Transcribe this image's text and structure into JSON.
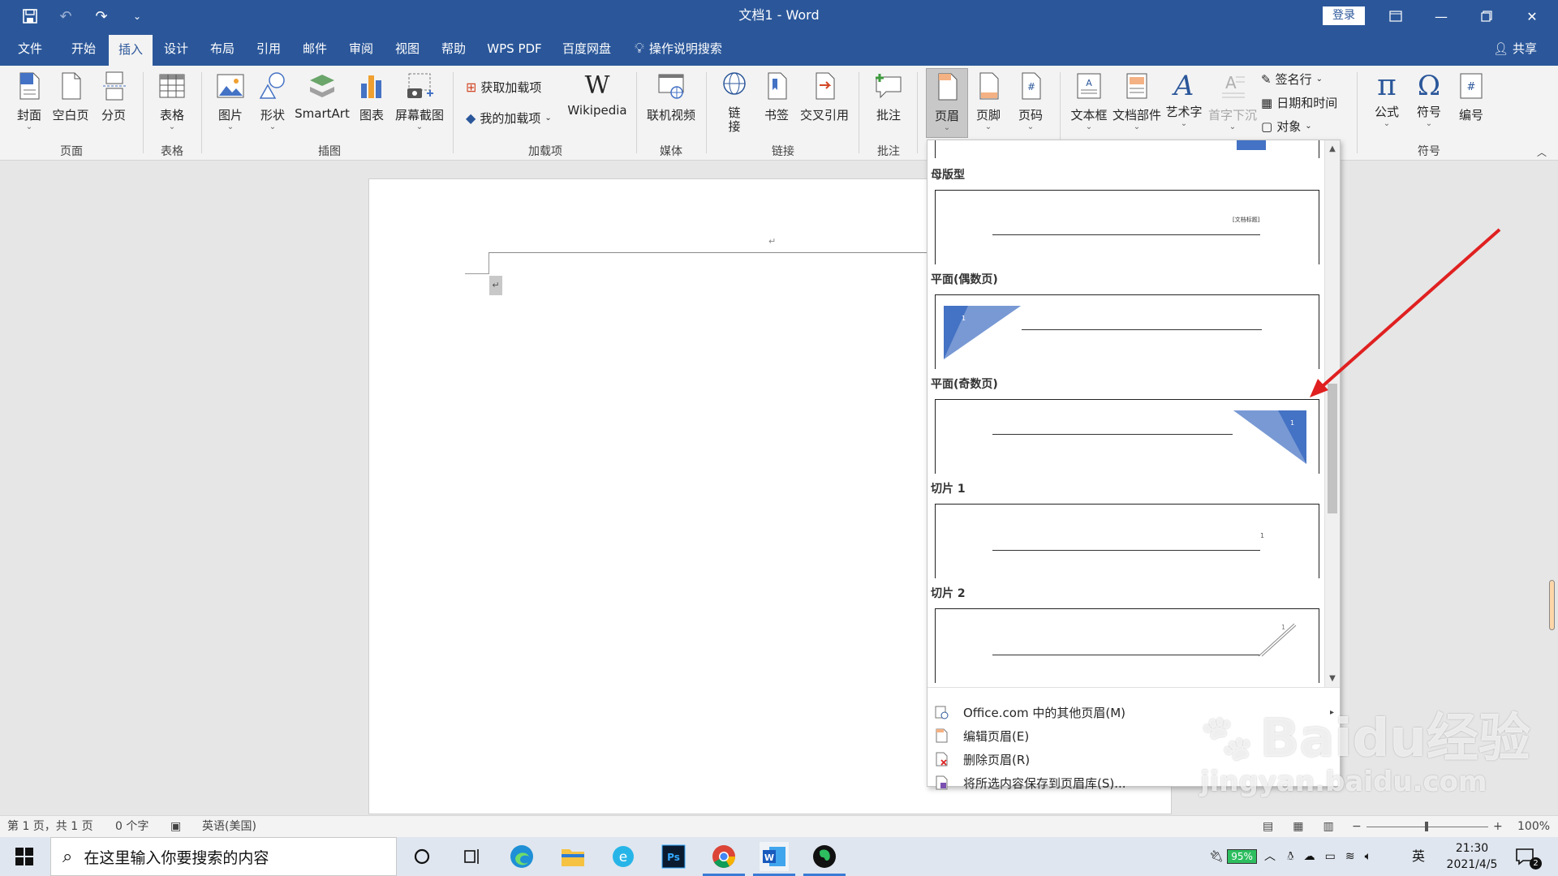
{
  "window": {
    "title": "文档1 - Word",
    "signin": "登录",
    "controls": [
      "restore-ribbon",
      "minimize",
      "maximize",
      "close"
    ]
  },
  "menu_tabs": [
    {
      "label": "文件",
      "active": false
    },
    {
      "label": "开始",
      "active": false
    },
    {
      "label": "插入",
      "active": true
    },
    {
      "label": "设计",
      "active": false
    },
    {
      "label": "布局",
      "active": false
    },
    {
      "label": "引用",
      "active": false
    },
    {
      "label": "邮件",
      "active": false
    },
    {
      "label": "审阅",
      "active": false
    },
    {
      "label": "视图",
      "active": false
    },
    {
      "label": "帮助",
      "active": false
    },
    {
      "label": "WPS PDF",
      "active": false
    },
    {
      "label": "百度网盘",
      "active": false
    },
    {
      "label": "操作说明搜索",
      "active": false
    }
  ],
  "share": "共享",
  "ribbon": {
    "groups": {
      "pages": "页面",
      "tables": "表格",
      "illustrations": "插图",
      "addins": "加载项",
      "media": "媒体",
      "links": "链接",
      "comments": "批注",
      "symbols": "符号"
    },
    "buttons": {
      "cover": "封面",
      "blank": "空白页",
      "pagebreak": "分页",
      "table": "表格",
      "picture": "图片",
      "shapes": "形状",
      "smartart": "SmartArt",
      "chart": "图表",
      "screenshot": "屏幕截图",
      "get_addins": "获取加载项",
      "my_addins": "我的加载项",
      "wikipedia": "Wikipedia",
      "online_video": "联机视频",
      "link": "链接",
      "bookmark": "书签",
      "crossref": "交叉引用",
      "comment": "批注",
      "header": "页眉",
      "footer": "页脚",
      "page_number": "页码",
      "textbox": "文本框",
      "quickparts": "文档部件",
      "wordart": "艺术字",
      "dropcap": "首字下沉",
      "signature": "签名行",
      "datetime": "日期和时间",
      "object": "对象",
      "equation": "公式",
      "symbol": "符号",
      "numbering": "编号"
    }
  },
  "header_gallery": {
    "sections": [
      {
        "label": "母版型",
        "style": "master",
        "sample_text": "[文档标题]"
      },
      {
        "label": "平面(偶数页)",
        "style": "even",
        "sample_text": "1"
      },
      {
        "label": "平面(奇数页)",
        "style": "odd",
        "sample_text": "1"
      },
      {
        "label": "切片 1",
        "style": "slice1",
        "sample_text": "1"
      },
      {
        "label": "切片 2",
        "style": "slice2",
        "sample_text": "1"
      }
    ],
    "menu": [
      {
        "label": "Office.com 中的其他页眉(M)",
        "has_submenu": true
      },
      {
        "label": "编辑页眉(E)",
        "has_submenu": false
      },
      {
        "label": "删除页眉(R)",
        "has_submenu": false
      },
      {
        "label": "将所选内容保存到页眉库(S)...",
        "has_submenu": false
      }
    ],
    "colors": {
      "accent": "#4472c4"
    }
  },
  "statusbar": {
    "page": "第 1 页，共 1 页",
    "words": "0 个字",
    "language": "英语(美国)",
    "zoom": "100%"
  },
  "watermark": {
    "logo": "Baidu经验",
    "url": "jingyan.baidu.com"
  },
  "taskbar": {
    "search_placeholder": "在这里输入你要搜索的内容",
    "battery": "95%",
    "ime": "英",
    "time": "21:30",
    "date": "2021/4/5",
    "notifications": "2"
  },
  "colors": {
    "brand": "#2b579a",
    "arrow": "#e02020"
  }
}
